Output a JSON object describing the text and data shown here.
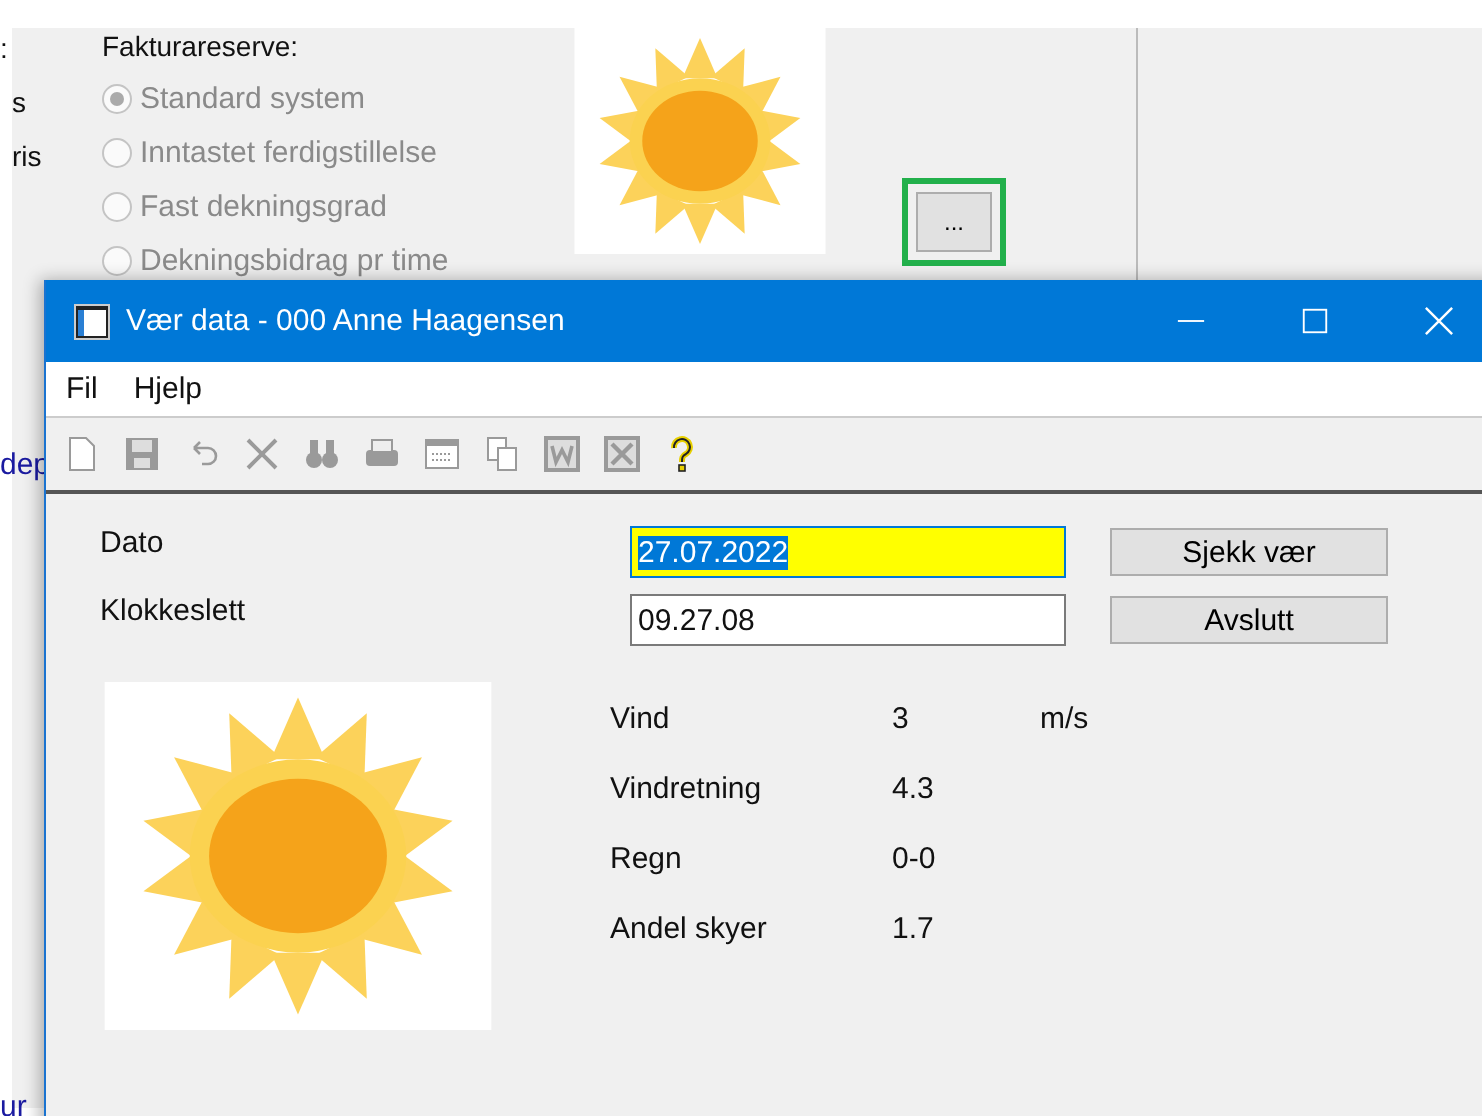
{
  "background_window": {
    "left_fragments": [
      ":",
      "s",
      "ris"
    ],
    "lower_fragments": [
      {
        "text": "dep",
        "kind": "link"
      },
      {
        "text": "ur",
        "kind": "link"
      }
    ],
    "group_label": "Fakturareserve:",
    "radio_options": [
      {
        "label": "Standard system",
        "selected": true,
        "disabled": true
      },
      {
        "label": "Inntastet ferdigstillelse",
        "selected": false,
        "disabled": true
      },
      {
        "label": "Fast dekningsgrad",
        "selected": false,
        "disabled": true
      },
      {
        "label": "Dekningsbidrag pr time",
        "selected": false,
        "disabled": true
      }
    ],
    "weather_button": {
      "label": "...",
      "highlighted": true
    }
  },
  "window": {
    "title": "Vær data - 000 Anne Haagensen",
    "menu": [
      "Fil",
      "Hjelp"
    ],
    "toolbar": [
      {
        "kind": "new",
        "disabled": true
      },
      {
        "kind": "save",
        "disabled": true
      },
      {
        "kind": "undo",
        "disabled": true
      },
      {
        "kind": "delete",
        "disabled": true
      },
      {
        "kind": "find",
        "disabled": true
      },
      {
        "kind": "print",
        "disabled": true
      },
      {
        "kind": "form",
        "disabled": true
      },
      {
        "kind": "copy",
        "disabled": true
      },
      {
        "kind": "word",
        "disabled": true
      },
      {
        "kind": "excel",
        "disabled": true
      },
      {
        "kind": "help",
        "disabled": false
      }
    ],
    "fields": [
      {
        "label": "Dato",
        "value": "27.07.2022",
        "focused": true,
        "button": "Sjekk vær"
      },
      {
        "label": "Klokkeslett",
        "value": "09.27.08",
        "focused": false,
        "button": "Avslutt"
      }
    ],
    "weather": [
      {
        "label": "Vind",
        "value": "3",
        "unit": "m/s"
      },
      {
        "label": "Vindretning",
        "value": "4.3"
      },
      {
        "label": "Regn",
        "value": "0-0"
      },
      {
        "label": "Andel skyer",
        "value": "1.7"
      }
    ]
  }
}
